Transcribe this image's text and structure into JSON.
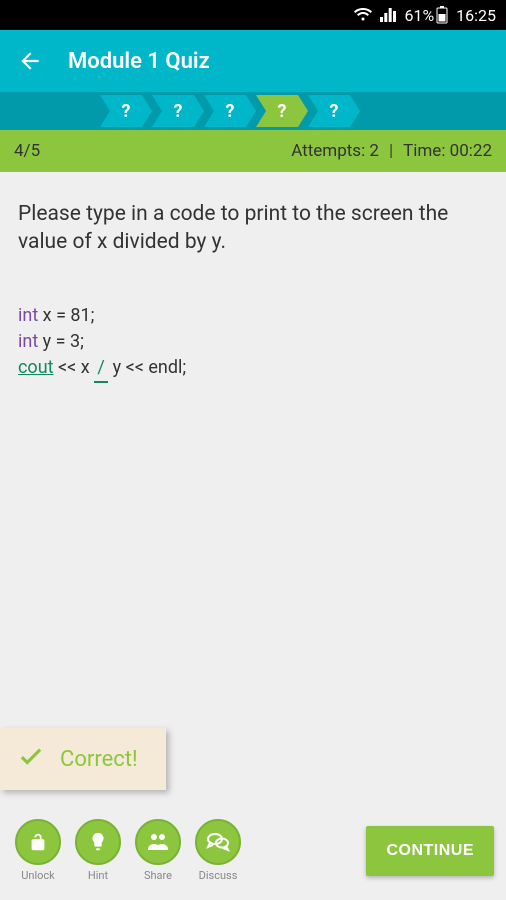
{
  "status": {
    "battery_pct": "61%",
    "time": "16:25"
  },
  "appbar": {
    "title": "Module 1 Quiz"
  },
  "progress": {
    "steps": [
      "?",
      "?",
      "?",
      "?",
      "?"
    ],
    "active_index": 3
  },
  "info": {
    "counter": "4/5",
    "attempts_label": "Attempts: 2",
    "time_label": "Time: 00:22"
  },
  "question": {
    "prompt": "Please type in a code to print to the screen the value of x divided by y."
  },
  "code": {
    "kw_int1": "int",
    "line1_rest": " x = 81;",
    "kw_int2": "int",
    "line2_rest": " y = 3;",
    "stream": "cout",
    "lt1": " << x ",
    "blank_val": "/",
    "after_blank": " y << endl;"
  },
  "feedback": {
    "correct_label": "Correct!"
  },
  "actions": {
    "unlock": "Unlock",
    "hint": "Hint",
    "share": "Share",
    "discuss": "Discuss",
    "continue": "CONTINUE"
  }
}
